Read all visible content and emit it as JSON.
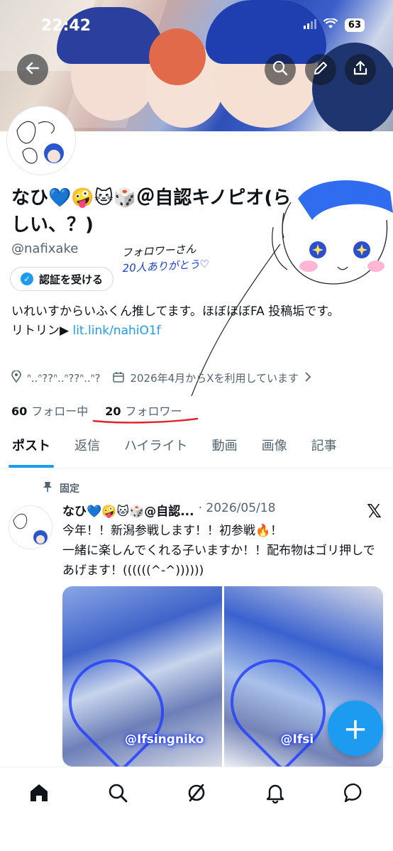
{
  "status_bar": {
    "time": "22:42",
    "battery": "63"
  },
  "header": {
    "back_icon": "arrow-left-icon",
    "actions": [
      "search-icon",
      "pencil-icon",
      "share-icon"
    ]
  },
  "profile": {
    "display_name": "なひ💙🤪🐱🎲＠自認キノピオ(らしい、？)",
    "handle": "@nafixake",
    "verify_label": "認証を受ける",
    "bio_line1": "いれいすからいふくん推してます。ほぼほぼFA 投稿垢です。",
    "bio_line2_prefix": "リトリン▶ ",
    "bio_link": "lit.link/nahiO1f",
    "location": "ᐢ..ᐢ??ᐢ..ᐢ??ᐢ..ᐢ?",
    "joined": "2026年4月からXを利用しています",
    "following_count": "60",
    "following_label": "フォロー中",
    "followers_count": "20",
    "followers_label": "フォロワー"
  },
  "doodle": {
    "line1": "フォロワーさん",
    "line2": "20人ありがとう♡"
  },
  "tabs": [
    "ポスト",
    "返信",
    "ハイライト",
    "動画",
    "画像",
    "記事"
  ],
  "post": {
    "pinned_label": "固定",
    "author": "なひ💙🤪🐱🎲@自認...",
    "date": "· 2026/05/18",
    "line1": "今年！！新潟参戦します！！初参戦🔥！",
    "line2": "一緒に楽しんでくれる子いますか！！配布物はゴリ押しであげます！((((((^-^))))))",
    "media_tag_1": "@Ifsingniko",
    "media_tag_2": "@Ifsi"
  },
  "fab_label": "+",
  "bottom_nav": [
    "home-icon",
    "search-icon",
    "grok-icon",
    "bell-icon",
    "message-icon"
  ],
  "colors": {
    "accent": "#1d9bf0",
    "text": "#0f1419",
    "secondary": "#536471",
    "underline": "#e0242a"
  }
}
